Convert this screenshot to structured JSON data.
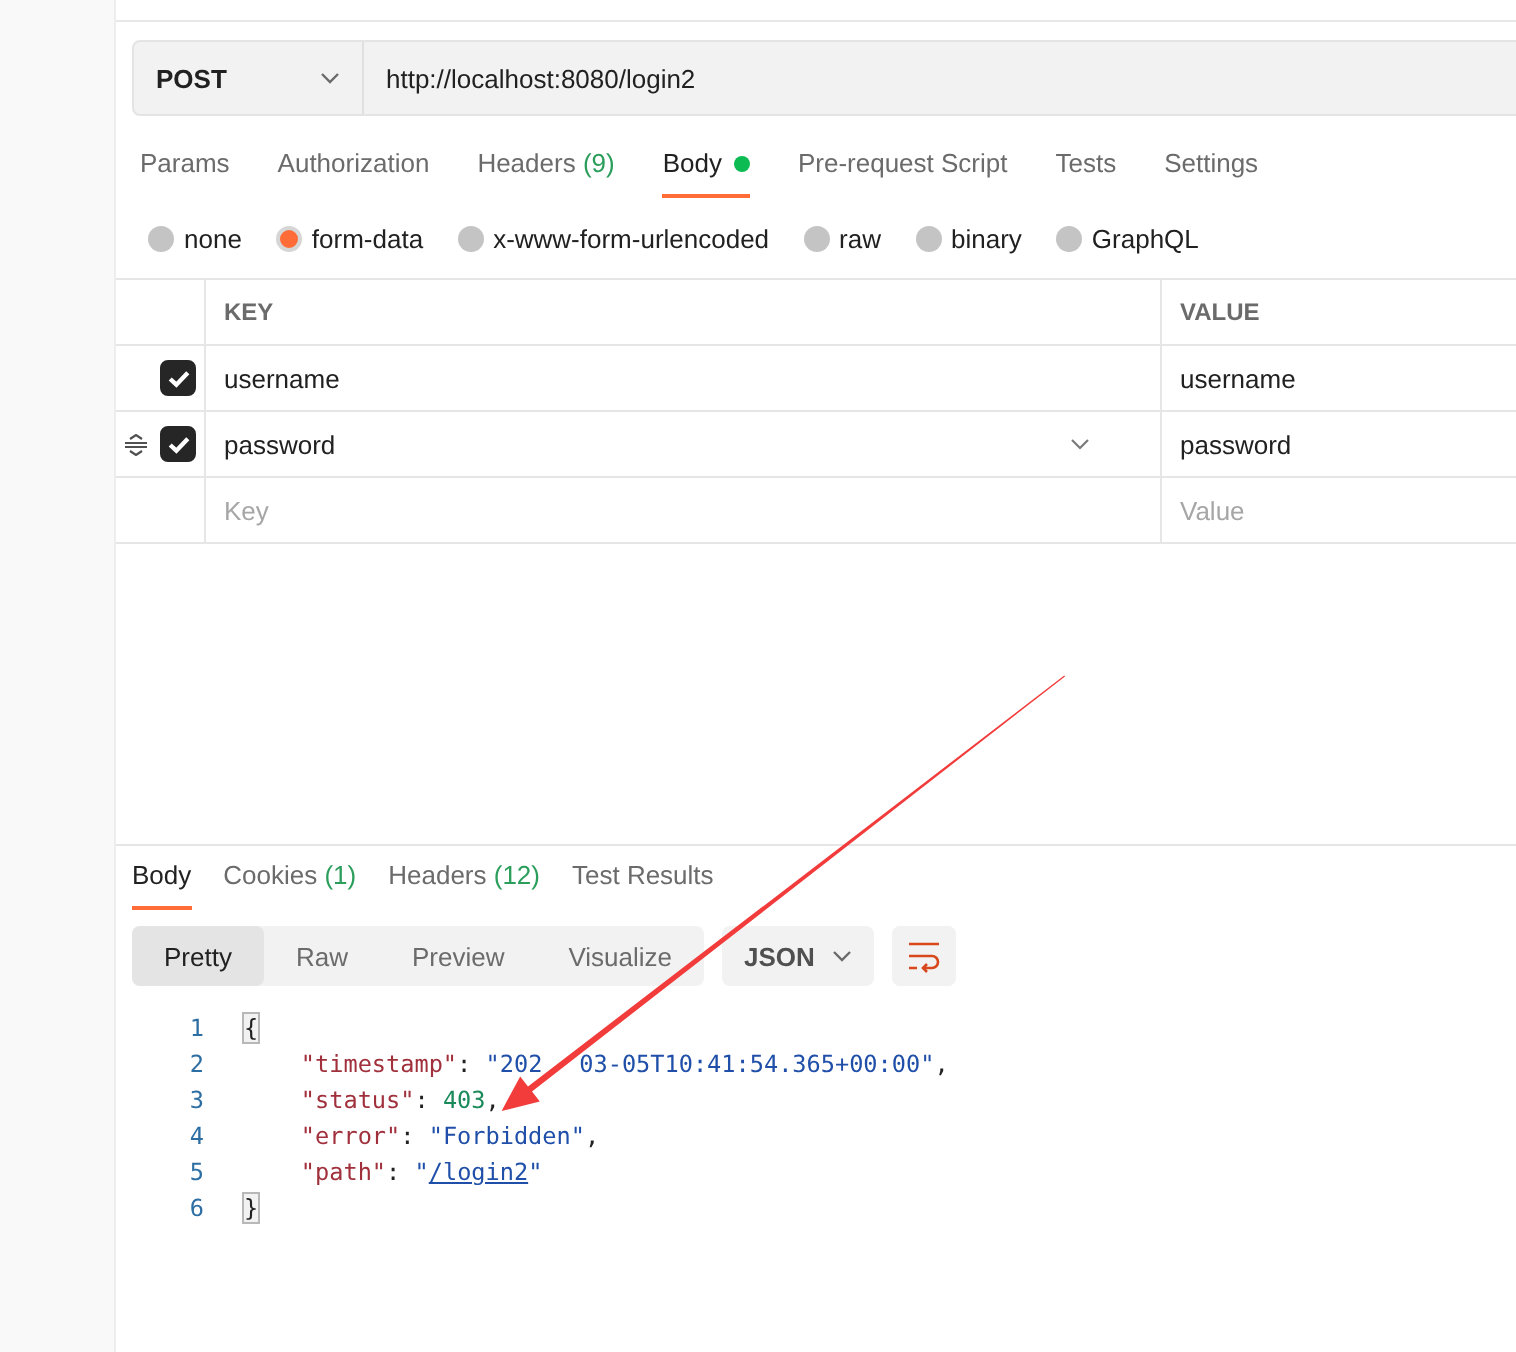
{
  "request": {
    "method": "POST",
    "url": "http://localhost:8080/login2"
  },
  "request_tabs": [
    {
      "label": "Params",
      "selected": false,
      "has_content": false
    },
    {
      "label": "Authorization",
      "selected": false,
      "has_content": false
    },
    {
      "label": "Headers",
      "count": "(9)",
      "selected": false,
      "has_content": false
    },
    {
      "label": "Body",
      "selected": true,
      "has_content": true
    },
    {
      "label": "Pre-request Script",
      "selected": false,
      "has_content": false
    },
    {
      "label": "Tests",
      "selected": false,
      "has_content": false
    },
    {
      "label": "Settings",
      "selected": false,
      "has_content": false
    }
  ],
  "body_types": [
    {
      "label": "none",
      "selected": false
    },
    {
      "label": "form-data",
      "selected": true
    },
    {
      "label": "x-www-form-urlencoded",
      "selected": false
    },
    {
      "label": "raw",
      "selected": false
    },
    {
      "label": "binary",
      "selected": false
    },
    {
      "label": "GraphQL",
      "selected": false
    }
  ],
  "params_table": {
    "columns": [
      "KEY",
      "VALUE"
    ],
    "rows": [
      {
        "key": "username",
        "value": "username",
        "checked": true,
        "hovered": false
      },
      {
        "key": "password",
        "value": "password",
        "checked": true,
        "hovered": true
      }
    ],
    "new_row": {
      "key": {
        "placeholder": "Key"
      },
      "value": {
        "placeholder": "Value"
      }
    }
  },
  "response_tabs": [
    {
      "label": "Body",
      "selected": true
    },
    {
      "label": "Cookies",
      "count": "(1)",
      "selected": false
    },
    {
      "label": "Headers",
      "count": "(12)",
      "selected": false
    },
    {
      "label": "Test Results",
      "selected": false
    }
  ],
  "view_modes": [
    {
      "label": "Pretty",
      "selected": true
    },
    {
      "label": "Raw",
      "selected": false
    },
    {
      "label": "Preview",
      "selected": false
    },
    {
      "label": "Visualize",
      "selected": false
    }
  ],
  "response_format": "JSON",
  "response_body": {
    "lines": [
      {
        "number": "1",
        "tokens": [
          {
            "kind": "bracket",
            "text": "{"
          }
        ],
        "children": [
          {
            "number": "2",
            "tokens": [
              {
                "kind": "key",
                "text": "\"timestamp\""
              },
              {
                "kind": "punct",
                "text": ": "
              },
              {
                "kind": "string",
                "text": "\"202"
              },
              {
                "kind": "covered"
              },
              {
                "kind": "string",
                "text": "03-05T10:41:54.365+00:00\""
              },
              {
                "kind": "punct",
                "text": ","
              }
            ]
          },
          {
            "number": "3",
            "tokens": [
              {
                "kind": "key",
                "text": "\"status\""
              },
              {
                "kind": "punct",
                "text": ": "
              },
              {
                "kind": "number",
                "text": "403"
              },
              {
                "kind": "punct",
                "text": ","
              }
            ]
          },
          {
            "number": "4",
            "tokens": [
              {
                "kind": "key",
                "text": "\"error\""
              },
              {
                "kind": "punct",
                "text": ": "
              },
              {
                "kind": "string",
                "text": "\"Forbidden\""
              },
              {
                "kind": "punct",
                "text": ","
              }
            ]
          },
          {
            "number": "5",
            "tokens": [
              {
                "kind": "key",
                "text": "\"path\""
              },
              {
                "kind": "punct",
                "text": ": "
              },
              {
                "kind": "string",
                "text": "\""
              },
              {
                "kind": "link",
                "text": "/login2"
              },
              {
                "kind": "string",
                "text": "\""
              }
            ]
          }
        ]
      },
      {
        "number": "6",
        "tokens": [
          {
            "kind": "bracket",
            "text": "}"
          }
        ]
      }
    ]
  },
  "annotations": [
    {
      "kind": "arrow"
    }
  ]
}
